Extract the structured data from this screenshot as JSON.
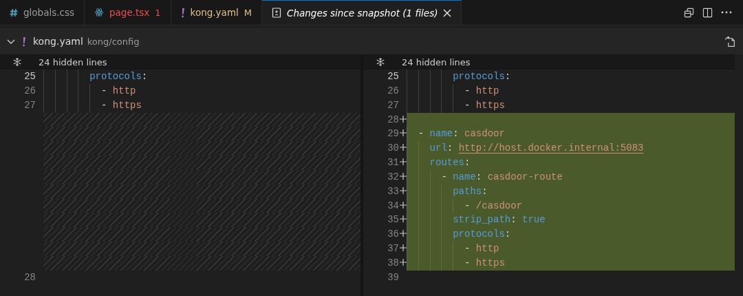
{
  "tabs": [
    {
      "kind": "file",
      "label": "globals.css",
      "color": "#9d9d9d",
      "selected": false
    },
    {
      "kind": "file",
      "label": "page.tsx",
      "badge": "1",
      "color": "#f14c4c",
      "selected": false
    },
    {
      "kind": "file",
      "label": "kong.yaml",
      "badge": "M",
      "color": "#e2c08d",
      "selected": false
    },
    {
      "kind": "diff",
      "label": "Changes since snapshot (1 files)",
      "color": "#ffffff",
      "selected": true,
      "closable": true
    }
  ],
  "file_header": {
    "expanded": true,
    "name": "kong.yaml",
    "path": "kong/config"
  },
  "panes": [
    {
      "hidden_lines": "24 hidden lines",
      "rows": [
        {
          "kind": "context",
          "number": "25",
          "tokens": [
            {
              "kind": "key",
              "text": "        protocols"
            },
            {
              "kind": "plain",
              "text": ":"
            }
          ]
        },
        {
          "kind": "context",
          "number": "26",
          "tokens": [
            {
              "kind": "plain",
              "text": "          - "
            },
            {
              "kind": "string",
              "text": "http"
            }
          ]
        },
        {
          "kind": "context",
          "number": "27",
          "tokens": [
            {
              "kind": "plain",
              "text": "          - "
            },
            {
              "kind": "string",
              "text": "https"
            }
          ]
        },
        {
          "kind": "filler"
        },
        {
          "kind": "filler"
        },
        {
          "kind": "filler"
        },
        {
          "kind": "filler"
        },
        {
          "kind": "filler"
        },
        {
          "kind": "filler"
        },
        {
          "kind": "filler"
        },
        {
          "kind": "filler"
        },
        {
          "kind": "filler"
        },
        {
          "kind": "filler"
        },
        {
          "kind": "filler"
        },
        {
          "kind": "context",
          "number": "28",
          "tokens": []
        }
      ]
    },
    {
      "hidden_lines": "24 hidden lines",
      "rows": [
        {
          "kind": "context",
          "number": "25",
          "tokens": [
            {
              "kind": "key",
              "text": "        protocols"
            },
            {
              "kind": "plain",
              "text": ":"
            }
          ]
        },
        {
          "kind": "context",
          "number": "26",
          "tokens": [
            {
              "kind": "plain",
              "text": "          - "
            },
            {
              "kind": "string",
              "text": "http"
            }
          ]
        },
        {
          "kind": "context",
          "number": "27",
          "tokens": [
            {
              "kind": "plain",
              "text": "          - "
            },
            {
              "kind": "string",
              "text": "https"
            }
          ]
        },
        {
          "kind": "added",
          "number": "28",
          "tokens": []
        },
        {
          "kind": "added",
          "number": "29",
          "tokens": [
            {
              "kind": "plain",
              "text": "  - "
            },
            {
              "kind": "key",
              "text": "name"
            },
            {
              "kind": "plain",
              "text": ": "
            },
            {
              "kind": "string",
              "text": "casdoor"
            }
          ]
        },
        {
          "kind": "added",
          "number": "30",
          "tokens": [
            {
              "kind": "key",
              "text": "    url"
            },
            {
              "kind": "plain",
              "text": ": "
            },
            {
              "kind": "link",
              "text": "http://host.docker.internal:5083"
            }
          ]
        },
        {
          "kind": "added",
          "number": "31",
          "tokens": [
            {
              "kind": "key",
              "text": "    routes"
            },
            {
              "kind": "plain",
              "text": ":"
            }
          ]
        },
        {
          "kind": "added",
          "number": "32",
          "tokens": [
            {
              "kind": "plain",
              "text": "      - "
            },
            {
              "kind": "key",
              "text": "name"
            },
            {
              "kind": "plain",
              "text": ": "
            },
            {
              "kind": "string",
              "text": "casdoor-route"
            }
          ]
        },
        {
          "kind": "added",
          "number": "33",
          "tokens": [
            {
              "kind": "key",
              "text": "        paths"
            },
            {
              "kind": "plain",
              "text": ":"
            }
          ]
        },
        {
          "kind": "added",
          "number": "34",
          "tokens": [
            {
              "kind": "plain",
              "text": "          - "
            },
            {
              "kind": "string",
              "text": "/casdoor"
            }
          ]
        },
        {
          "kind": "added",
          "number": "35",
          "tokens": [
            {
              "kind": "key",
              "text": "        strip_path"
            },
            {
              "kind": "plain",
              "text": ": "
            },
            {
              "kind": "bool",
              "text": "true"
            }
          ]
        },
        {
          "kind": "added",
          "number": "36",
          "tokens": [
            {
              "kind": "key",
              "text": "        protocols"
            },
            {
              "kind": "plain",
              "text": ":"
            }
          ]
        },
        {
          "kind": "added",
          "number": "37",
          "tokens": [
            {
              "kind": "plain",
              "text": "          - "
            },
            {
              "kind": "string",
              "text": "http"
            }
          ]
        },
        {
          "kind": "added",
          "number": "38",
          "tokens": [
            {
              "kind": "plain",
              "text": "          - "
            },
            {
              "kind": "string",
              "text": "https"
            }
          ]
        },
        {
          "kind": "context",
          "number": "39",
          "tokens": []
        }
      ]
    }
  ]
}
